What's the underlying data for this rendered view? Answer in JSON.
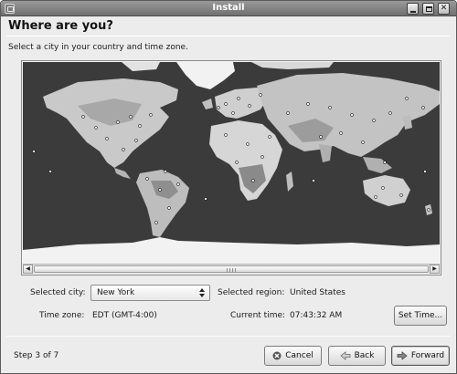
{
  "window": {
    "title": "Install"
  },
  "page": {
    "heading": "Where are you?",
    "instruction": "Select a city in your country and time zone."
  },
  "icons": {
    "app": "installer-icon",
    "minimize": "minimize-icon",
    "maximize": "maximize-icon",
    "close": "close-icon",
    "scroll_left": "arrow-left-icon",
    "scroll_right": "arrow-right-icon",
    "combo": "spinner-arrows-icon",
    "cancel": "cancel-x-icon",
    "back": "back-arrow-icon",
    "forward": "forward-arrow-icon"
  },
  "fields": {
    "selected_city_label": "Selected city:",
    "selected_city_value": "New York",
    "selected_region_label": "Selected region:",
    "selected_region_value": "United States",
    "time_zone_label": "Time zone:",
    "time_zone_value": "EDT (GMT-4:00)",
    "current_time_label": "Current time:",
    "current_time_value": "07:43:32 AM"
  },
  "buttons": {
    "set_time": "Set Time...",
    "cancel": "Cancel",
    "back": "Back",
    "forward": "Forward"
  },
  "footer": {
    "step": "Step 3 of 7"
  },
  "colors": {
    "ocean": "#3b3b3b",
    "land": "#c9c9c9",
    "snow": "#f2f2f2",
    "city_dot": "#ffffff"
  }
}
